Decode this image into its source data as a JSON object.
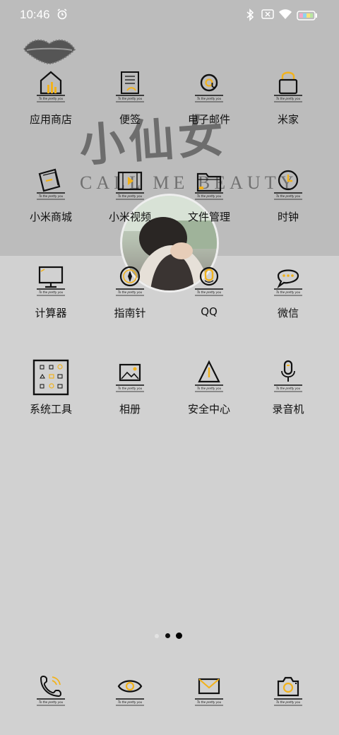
{
  "status_bar": {
    "time": "10:46",
    "icons": [
      "alarm-icon",
      "bluetooth-icon",
      "sim-disabled-icon",
      "wifi-icon",
      "battery-icon"
    ]
  },
  "wallpaper": {
    "title": "小仙女",
    "subtitle": "CALL ME  BEAUTY",
    "decorations": [
      "lips-icon",
      "avatar-photo"
    ]
  },
  "icon_motto": "To the pretty you",
  "accent_color": "#f2b21b",
  "apps": [
    {
      "label": "应用商店",
      "icon": "store-house-icon"
    },
    {
      "label": "便签",
      "icon": "notepad-icon"
    },
    {
      "label": "电子邮件",
      "icon": "email-at-icon"
    },
    {
      "label": "米家",
      "icon": "smart-lock-icon"
    },
    {
      "label": "小米商城",
      "icon": "shop-book-icon"
    },
    {
      "label": "小米视频",
      "icon": "video-play-icon"
    },
    {
      "label": "文件管理",
      "icon": "folder-icon"
    },
    {
      "label": "时钟",
      "icon": "clock-icon"
    },
    {
      "label": "计算器",
      "icon": "monitor-icon"
    },
    {
      "label": "指南针",
      "icon": "compass-icon"
    },
    {
      "label": "QQ",
      "icon": "qq-penguin-icon"
    },
    {
      "label": "微信",
      "icon": "chat-bubble-icon"
    },
    {
      "label": "系统工具",
      "icon": "tools-folder-icon"
    },
    {
      "label": "相册",
      "icon": "gallery-icon"
    },
    {
      "label": "安全中心",
      "icon": "security-triangle-icon"
    },
    {
      "label": "录音机",
      "icon": "microphone-icon"
    }
  ],
  "page_indicator": {
    "pages": 3,
    "current": 3
  },
  "dock": [
    {
      "icon": "phone-icon"
    },
    {
      "icon": "eye-icon"
    },
    {
      "icon": "message-envelope-icon"
    },
    {
      "icon": "camera-icon"
    }
  ]
}
